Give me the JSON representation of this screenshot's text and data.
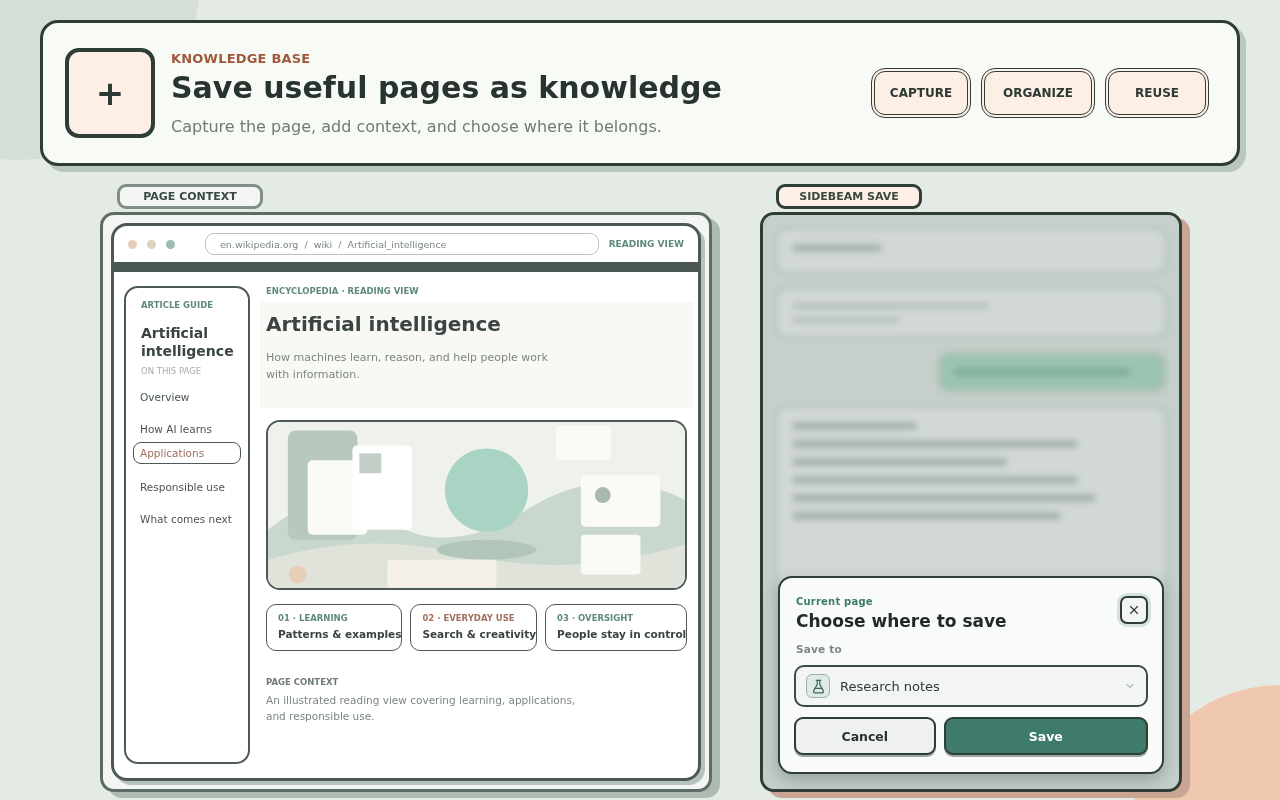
{
  "header": {
    "glyph": "+",
    "eyebrow": "KNOWLEDGE BASE",
    "title": "Save useful pages as knowledge",
    "subtitle": "Capture the page, add context, and choose where it belongs.",
    "steps": [
      "CAPTURE",
      "ORGANIZE",
      "REUSE"
    ]
  },
  "context_panel": {
    "label": "PAGE CONTEXT",
    "browser": {
      "url": "en.wikipedia.org  /  wiki  /  Artificial_intelligence",
      "mode": "READING VIEW"
    },
    "guide": {
      "eyebrow": "ARTICLE GUIDE",
      "title": "Artificial intelligence",
      "section_label": "ON THIS PAGE",
      "items": [
        {
          "label": "Overview",
          "selected": false
        },
        {
          "label": "How AI learns",
          "selected": false
        },
        {
          "label": "Applications",
          "selected": true
        },
        {
          "label": "Responsible use",
          "selected": false
        },
        {
          "label": "What comes next",
          "selected": false
        }
      ]
    },
    "article": {
      "eyebrow": "ENCYCLOPEDIA · READING VIEW",
      "title": "Artificial intelligence",
      "lede": "How machines learn, reason, and help people work with information."
    },
    "cards": [
      {
        "eyebrow": "01 · LEARNING",
        "title": "Patterns & examples",
        "color": "#5f8a78"
      },
      {
        "eyebrow": "02 · EVERYDAY USE",
        "title": "Search & creativity",
        "color": "#a0715a"
      },
      {
        "eyebrow": "03 · OVERSIGHT",
        "title": "People stay in control",
        "color": "#5f8a78"
      }
    ],
    "page_context": {
      "label": "PAGE CONTEXT",
      "text": "An illustrated reading view covering learning, applications, and responsible use."
    }
  },
  "save_panel": {
    "label": "SIDEBEAM SAVE",
    "dialog": {
      "eyebrow": "Current page",
      "title": "Choose where to save",
      "field_label": "Save to",
      "value": "Research notes",
      "buttons": [
        {
          "label": "Cancel",
          "kind": "secondary"
        },
        {
          "label": "Save",
          "kind": "primary"
        }
      ]
    }
  }
}
